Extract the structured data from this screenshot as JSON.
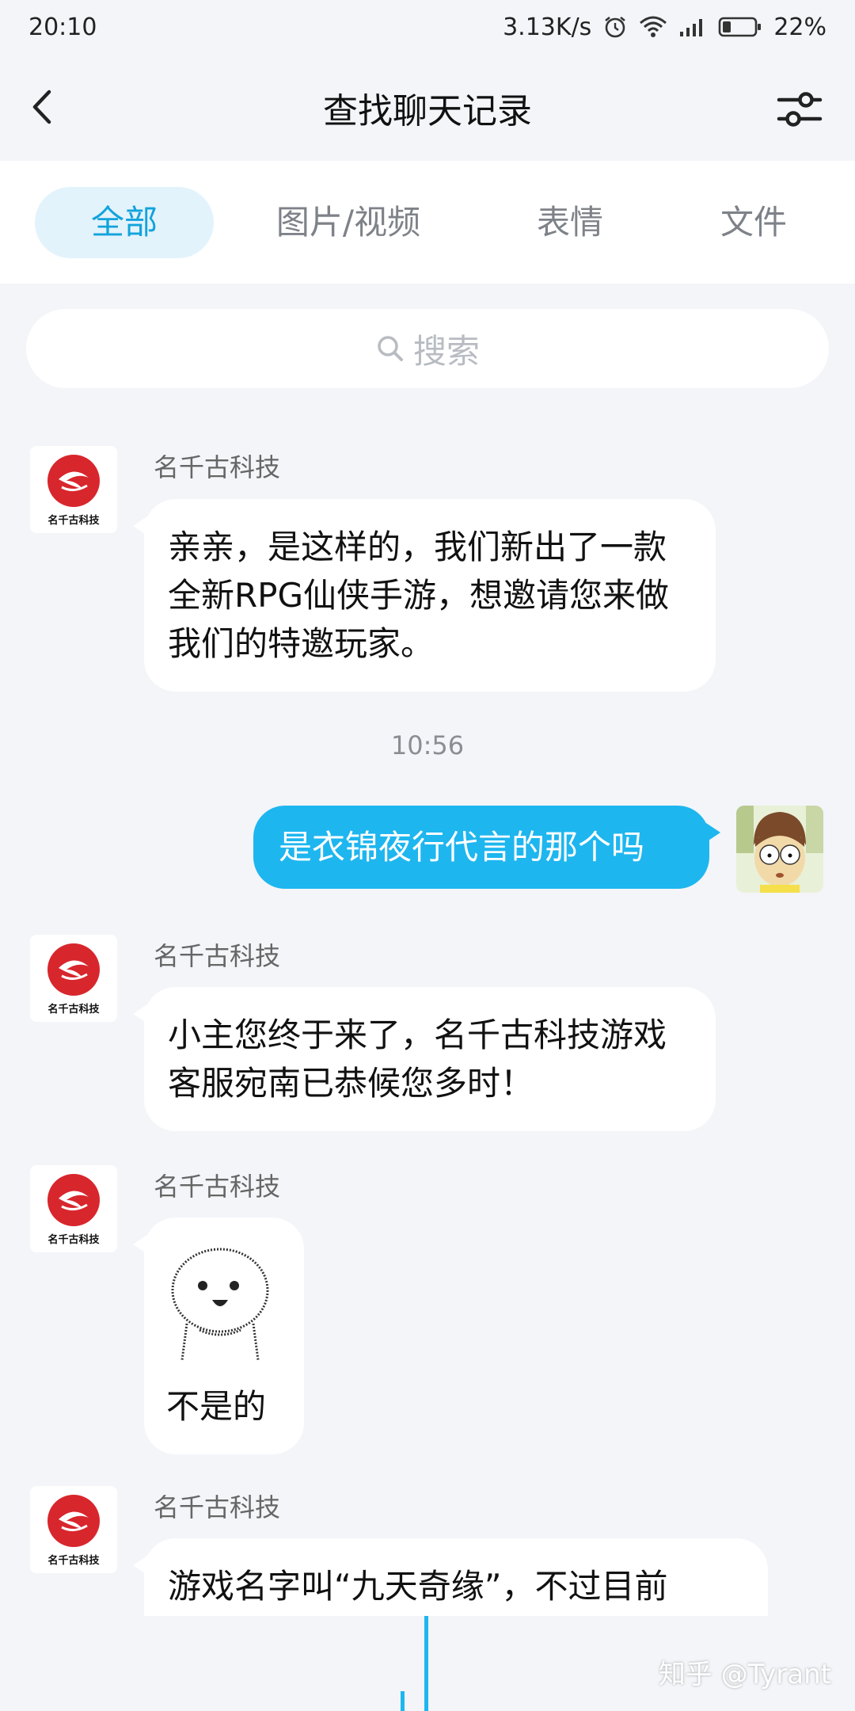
{
  "status_bar": {
    "time": "20:10",
    "net_speed": "3.13K/s",
    "battery": "22%",
    "icons": [
      "alarm-icon",
      "wifi-icon",
      "signal-icon",
      "battery-icon"
    ]
  },
  "header": {
    "title": "查找聊天记录",
    "back_icon": "chevron-left-icon",
    "filter_icon": "sliders-icon"
  },
  "tabs": [
    {
      "label": "全部",
      "active": true
    },
    {
      "label": "图片/视频",
      "active": false
    },
    {
      "label": "表情",
      "active": false
    },
    {
      "label": "文件",
      "active": false
    }
  ],
  "search": {
    "placeholder": "搜索",
    "icon": "search-icon"
  },
  "messages": [
    {
      "sender": "名千古科技",
      "avatar_text": "名千古科技",
      "text": "亲亲，是这样的，我们新出了一款全新RPG仙侠手游，想邀请您来做我们的特邀玩家。"
    },
    {
      "timestamp": "10:56"
    },
    {
      "mine": true,
      "text": "是衣锦夜行代言的那个吗"
    },
    {
      "sender": "名千古科技",
      "avatar_text": "名千古科技",
      "text": "小主您终于来了，名千古科技游戏客服宛南已恭候您多时！"
    },
    {
      "sender": "名千古科技",
      "avatar_text": "名千古科技",
      "sticker": "stick-figure-sticker",
      "text": "不是的"
    },
    {
      "sender": "名千古科技",
      "avatar_text": "名千古科技",
      "text": "游戏名字叫“九天奇缘”，不过目前"
    }
  ],
  "watermark": "知乎 @Tyrant",
  "colors": {
    "accent": "#1eb6ef",
    "tab_active_bg": "#e3f3fb",
    "tab_active_text": "#12a3dc",
    "background": "#f3f5f9",
    "logo_red": "#d8262d"
  }
}
